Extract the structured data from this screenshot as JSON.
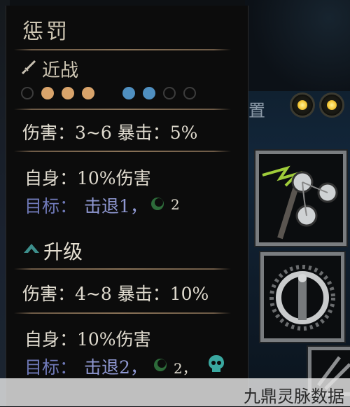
{
  "tooltip": {
    "title": "惩罚",
    "attack_type": "近战",
    "launch_positions": [
      {
        "color": "#d9a46b",
        "active": false
      },
      {
        "color": "#d9a46b",
        "active": true
      },
      {
        "color": "#d9a46b",
        "active": true
      },
      {
        "color": "#d9a46b",
        "active": true
      }
    ],
    "target_positions": [
      {
        "color": "#4f8fc0",
        "active": true
      },
      {
        "color": "#4f8fc0",
        "active": true
      },
      {
        "color": "#4f8fc0",
        "active": false
      },
      {
        "color": "#4f8fc0",
        "active": false
      }
    ],
    "base": {
      "stats": "伤害：3~6 暴击：5%",
      "self": "自身：10%伤害",
      "target_label": "目标：",
      "target_effect": "击退1，",
      "target_extra": "2"
    },
    "upgrade": {
      "label": "升级",
      "stats": "伤害：4~8 暴击：10%",
      "self": "自身：10%伤害",
      "target_label": "目标：",
      "target_effect": "击退2，",
      "target_extra": "2，"
    }
  },
  "background": {
    "slot_label": "置"
  },
  "watermark": "九鼎灵脉数据"
}
